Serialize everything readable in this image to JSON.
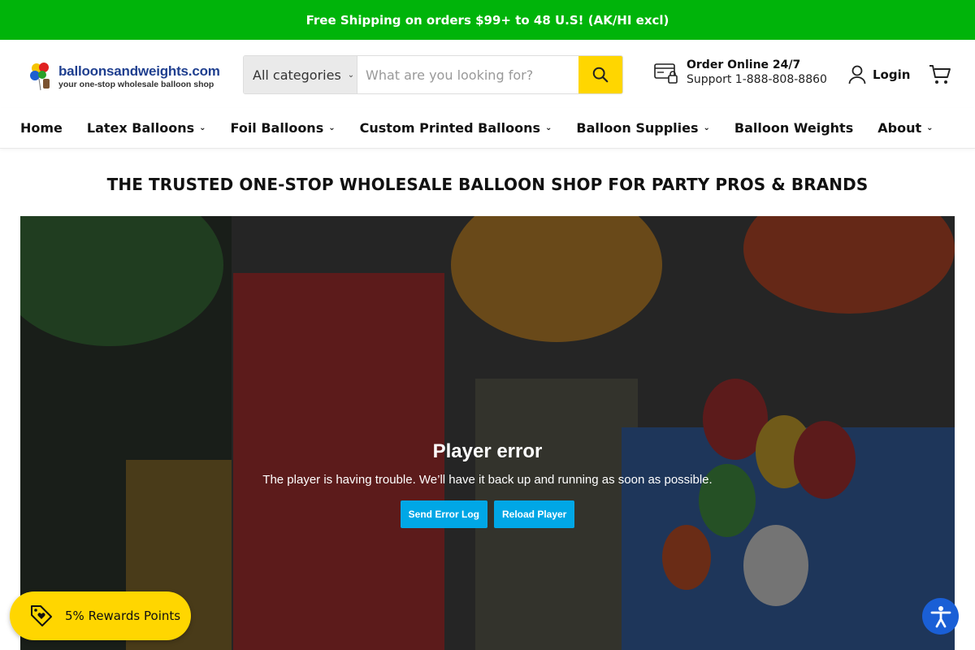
{
  "announcement": "Free Shipping on orders $99+ to 48 U.S! (AK/HI excl)",
  "logo": {
    "name": "balloonsandweights.com",
    "tagline": "your one-stop wholesale balloon shop"
  },
  "search": {
    "category": "All categories",
    "placeholder": "What are you looking for?"
  },
  "order": {
    "title": "Order Online 24/7",
    "support": "Support 1-888-808-8860"
  },
  "account": {
    "login_label": "Login"
  },
  "nav": {
    "items": [
      {
        "label": "Home",
        "dropdown": false
      },
      {
        "label": "Latex Balloons",
        "dropdown": true
      },
      {
        "label": "Foil Balloons",
        "dropdown": true
      },
      {
        "label": "Custom Printed Balloons",
        "dropdown": true
      },
      {
        "label": "Balloon Supplies",
        "dropdown": true
      },
      {
        "label": "Balloon Weights",
        "dropdown": false
      },
      {
        "label": "About",
        "dropdown": true
      }
    ]
  },
  "headline": "THE TRUSTED ONE-STOP WHOLESALE BALLOON SHOP FOR PARTY PROS & BRANDS",
  "player": {
    "error_title": "Player error",
    "error_message": "The player is having trouble. We’ll have it back up and running as soon as possible.",
    "send_log_label": "Send Error Log",
    "reload_label": "Reload Player"
  },
  "rewards": {
    "label": "5% Rewards Points"
  },
  "colors": {
    "announce_green": "#00b40a",
    "accent_yellow": "#ffd600",
    "player_button": "#00a7e6",
    "a11y_blue": "#1a5fd6"
  }
}
